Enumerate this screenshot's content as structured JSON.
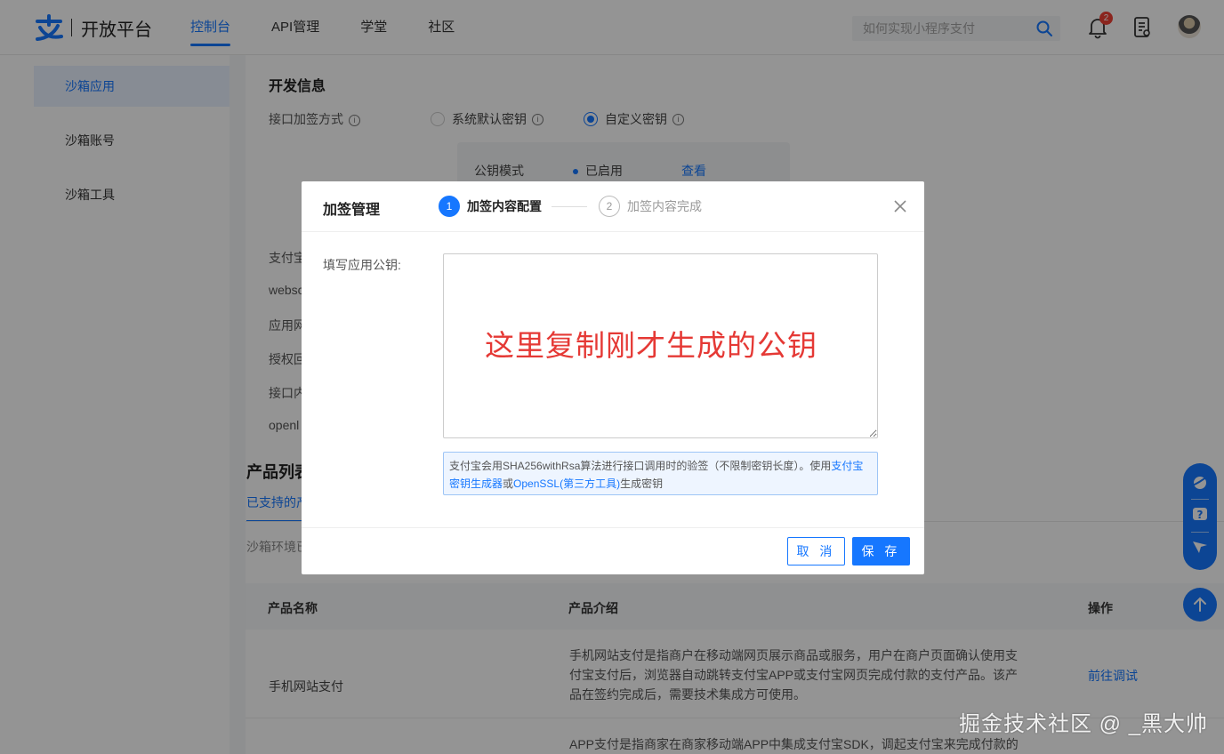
{
  "header": {
    "logo_text": "开放平台",
    "nav": [
      {
        "label": "控制台",
        "active": true
      },
      {
        "label": "API管理",
        "active": false
      },
      {
        "label": "学堂",
        "active": false
      },
      {
        "label": "社区",
        "active": false
      }
    ],
    "search_placeholder": "如何实现小程序支付",
    "notification_count": "2"
  },
  "sidebar": {
    "items": [
      {
        "label": "沙箱应用",
        "active": true
      },
      {
        "label": "沙箱账号",
        "active": false
      },
      {
        "label": "沙箱工具",
        "active": false
      }
    ]
  },
  "main": {
    "section_title": "开发信息",
    "sign_method_label": "接口加签方式",
    "radio_default": "系统默认密钥",
    "radio_custom": "自定义密钥",
    "key_box": {
      "label": "公钥模式",
      "status": "已启用",
      "view": "查看"
    },
    "partial_labels": [
      "支付宝",
      "websc",
      "应用网",
      "授权回",
      "接口内",
      "openl"
    ],
    "product_title": "产品列表",
    "product_tab": "已支持的产",
    "sandbox_note": "沙箱环境已",
    "table": {
      "headers": [
        "产品名称",
        "产品介绍",
        "操作"
      ],
      "rows": [
        {
          "name": "手机网站支付",
          "desc_lines": [
            "手机网站支付是指商户在移动端网页展示商品或服务，用户在商户页面确认使用支",
            "付宝支付后，浏览器自动跳转支付宝APP或支付宝网页完成付款的支付产品。该产",
            "品在签约完成后，需要技术集成方可使用。"
          ],
          "action": "前往调试"
        },
        {
          "name": "",
          "desc_lines": [
            "APP支付是指商家在商家移动端APP中集成支付宝SDK，调起支付宝来完成付款的"
          ],
          "action": ""
        }
      ]
    }
  },
  "modal": {
    "title": "加签管理",
    "step1_num": "1",
    "step1_label": "加签内容配置",
    "step2_num": "2",
    "step2_label": "加签内容完成",
    "field_label": "填写应用公钥:",
    "textarea_value": "",
    "annotation": "这里复制刚才生成的公钥",
    "tip_prefix": "支付宝会用SHA256withRsa算法进行接口调用时的验签（不限制密钥长度）。使用",
    "tip_link1": "支付宝密钥生成器",
    "tip_mid": "或",
    "tip_link2": "OpenSSL(第三方工具)",
    "tip_suffix": "生成密钥",
    "cancel_label": "取 消",
    "save_label": "保 存"
  },
  "watermark": "掘金技术社区 @ _黑大帅",
  "colors": {
    "accent": "#1677ff",
    "danger": "#e53935"
  }
}
